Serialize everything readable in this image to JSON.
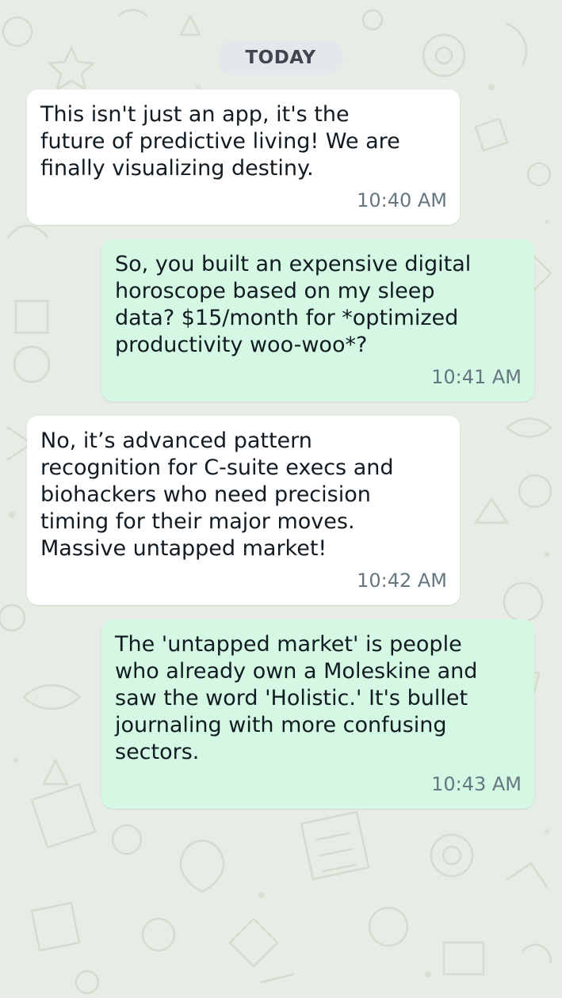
{
  "chat": {
    "date_separator": "TODAY",
    "messages": [
      {
        "direction": "incoming",
        "text": "This isn't just an app, it's the\nfuture of predictive living! We are\nfinally visualizing destiny.",
        "time": "10:40 AM"
      },
      {
        "direction": "outgoing",
        "text": "So, you built an expensive digital\nhoroscope based on my sleep\ndata? $15/month for *optimized\nproductivity woo-woo*?",
        "time": "10:41 AM"
      },
      {
        "direction": "incoming",
        "text": "No, it’s advanced pattern\nrecognition for C-suite execs and\nbiohackers who need precision\ntiming for their major moves.\nMassive untapped market!",
        "time": "10:42 AM"
      },
      {
        "direction": "outgoing",
        "text": "The 'untapped market' is people\nwho already own a Moleskine and\nsaw the word 'Holistic.' It's bullet\njournaling with more confusing\nsectors.",
        "time": "10:43 AM"
      }
    ]
  },
  "colors": {
    "background": "#e6ede4",
    "incoming_bubble": "#ffffff",
    "outgoing_bubble": "#d4f8e4",
    "timestamp": "#667781",
    "date_chip": "#e4e8ea"
  }
}
